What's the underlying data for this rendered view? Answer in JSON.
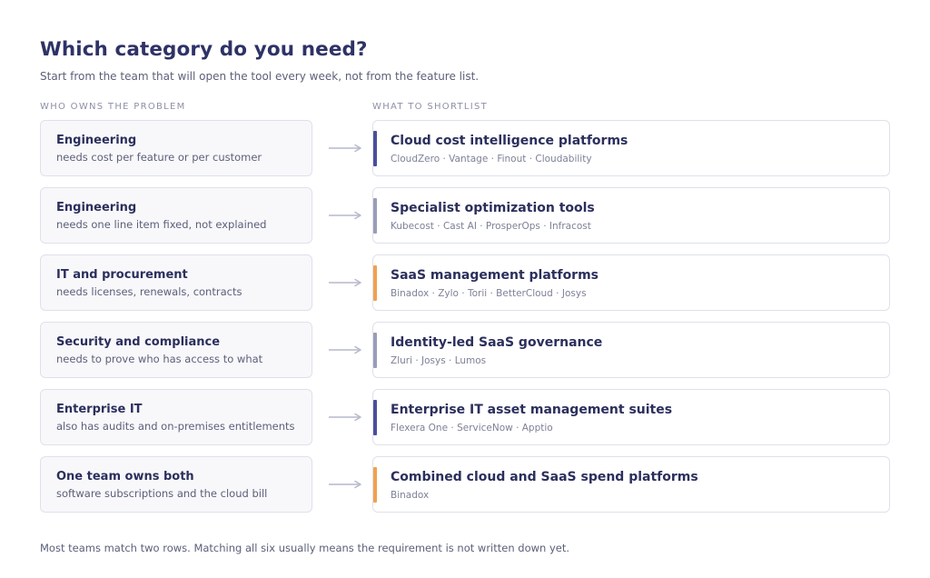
{
  "header": {
    "title": "Which category do you need?",
    "subtitle": "Start from the team that will open the tool every week, not from the feature list."
  },
  "columns": {
    "left": "WHO OWNS THE PROBLEM",
    "right": "WHAT TO SHORTLIST"
  },
  "colors": {
    "accent_navy": "#4a4f9c",
    "accent_grey": "#9a9db6",
    "accent_orange": "#f1a04e",
    "arrow": "#b6b9cc"
  },
  "rows": [
    {
      "owner": "Engineering",
      "need": "needs cost per feature or per customer",
      "category": "Cloud cost intelligence platforms",
      "vendors": "CloudZero · Vantage · Finout · Cloudability",
      "accent": "#4a4f9c"
    },
    {
      "owner": "Engineering",
      "need": "needs one line item fixed, not explained",
      "category": "Specialist optimization tools",
      "vendors": "Kubecost · Cast AI · ProsperOps · Infracost",
      "accent": "#9a9db6"
    },
    {
      "owner": "IT and procurement",
      "need": "needs licenses, renewals, contracts",
      "category": "SaaS management platforms",
      "vendors": "Binadox · Zylo · Torii · BetterCloud · Josys",
      "accent": "#f1a04e"
    },
    {
      "owner": "Security and compliance",
      "need": "needs to prove who has access to what",
      "category": "Identity-led SaaS governance",
      "vendors": "Zluri · Josys · Lumos",
      "accent": "#9a9db6"
    },
    {
      "owner": "Enterprise IT",
      "need": "also has audits and on-premises entitlements",
      "category": "Enterprise IT asset management suites",
      "vendors": "Flexera One · ServiceNow · Apptio",
      "accent": "#4a4f9c"
    },
    {
      "owner": "One team owns both",
      "need": "software subscriptions and the cloud bill",
      "category": "Combined cloud and SaaS spend platforms",
      "vendors": "Binadox",
      "accent": "#f1a04e"
    }
  ],
  "footer": "Most teams match two rows. Matching all six usually means the requirement is not written down yet."
}
